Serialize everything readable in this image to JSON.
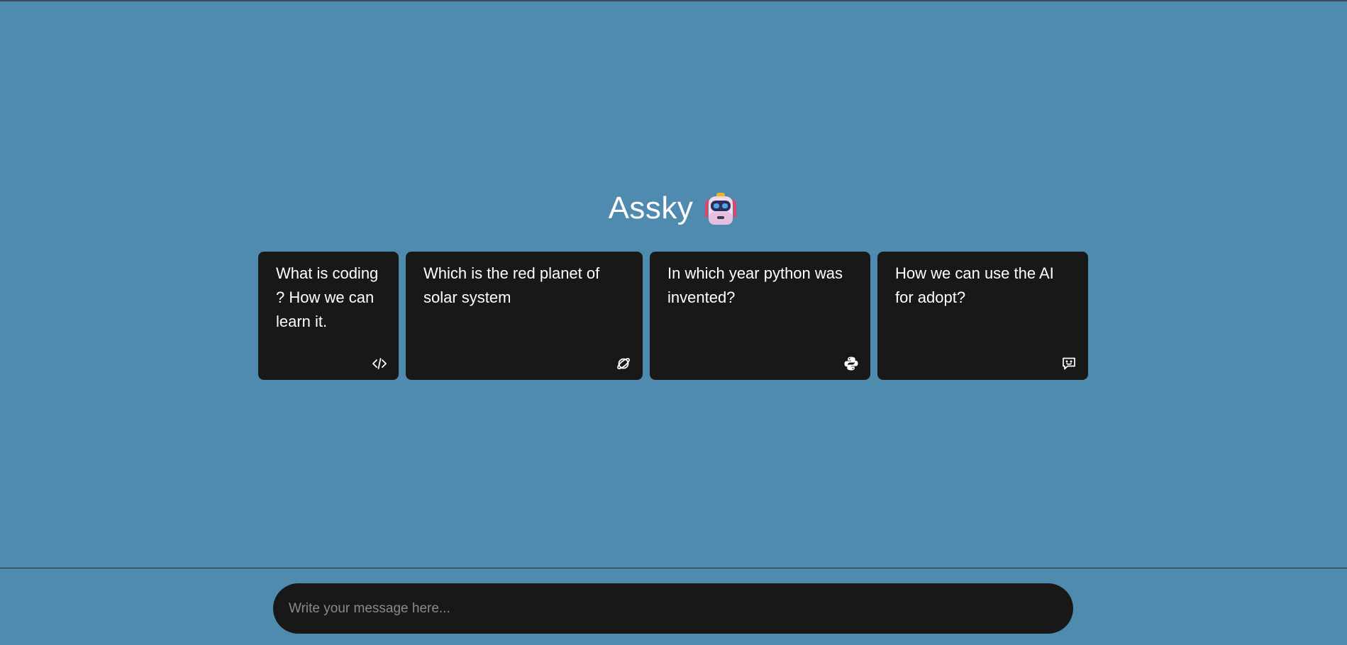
{
  "app": {
    "title": "Assky",
    "logo_icon": "robot-icon"
  },
  "colors": {
    "background": "#4f8baf",
    "card": "#181818",
    "text": "#ffffff",
    "placeholder": "#8a8a8a"
  },
  "cards": [
    {
      "text": "What is coding ? How we can learn it.",
      "icon": "code-icon"
    },
    {
      "text": "Which is the red planet of solar system",
      "icon": "planet-icon"
    },
    {
      "text": "In which year python was invented?",
      "icon": "python-icon"
    },
    {
      "text": "How we can use the AI for adopt?",
      "icon": "chat-icon"
    }
  ],
  "composer": {
    "placeholder": "Write your message here..."
  }
}
